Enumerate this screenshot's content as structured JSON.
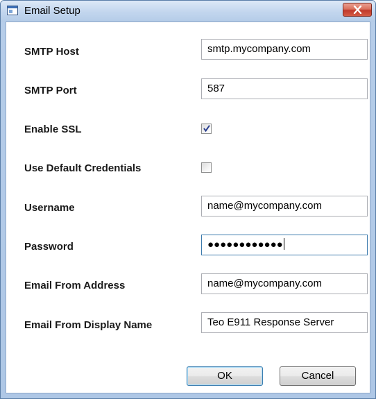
{
  "window": {
    "title": "Email Setup"
  },
  "form": {
    "smtp_host": {
      "label": "SMTP Host",
      "value": "smtp.mycompany.com"
    },
    "smtp_port": {
      "label": "SMTP Port",
      "value": "587"
    },
    "enable_ssl": {
      "label": "Enable SSL",
      "checked": true
    },
    "use_default_credentials": {
      "label": "Use Default Credentials",
      "checked": false
    },
    "username": {
      "label": "Username",
      "value": "name@mycompany.com"
    },
    "password": {
      "label": "Password",
      "masked_value": "●●●●●●●●●●●●"
    },
    "email_from_address": {
      "label": "Email From Address",
      "value": "name@mycompany.com"
    },
    "email_from_display_name": {
      "label": "Email From Display Name",
      "value": "Teo E911 Response Server"
    }
  },
  "buttons": {
    "ok_label": "OK",
    "cancel_label": "Cancel"
  },
  "icons": {
    "app": "window-app-icon",
    "close": "close-icon",
    "check": "checkmark-icon"
  },
  "colors": {
    "titlebar": "#c2d6ee",
    "close_button": "#c0392b",
    "default_button_border": "#3c7fb1"
  }
}
